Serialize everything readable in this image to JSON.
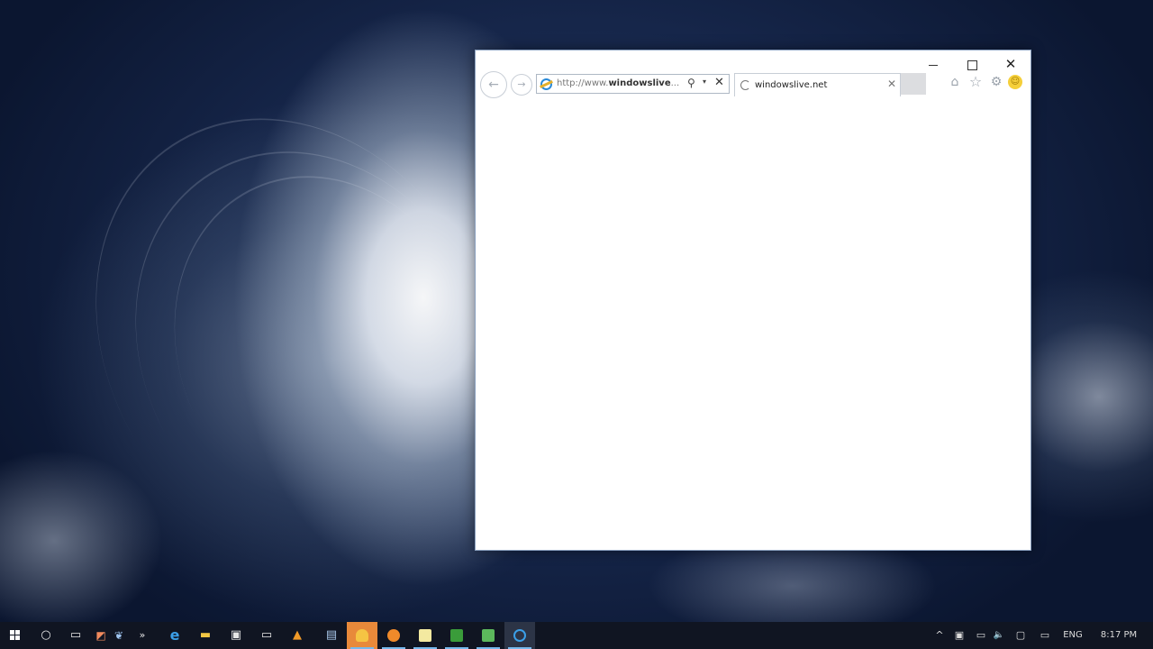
{
  "browser": {
    "window_controls": {
      "minimize": "─",
      "maximize": "",
      "close": "✕"
    },
    "nav": {
      "back_icon": "←",
      "forward_icon": "→"
    },
    "address": {
      "prefix": "http://www.",
      "domain": "windowslive",
      "suffix": "...",
      "search_icon": "⚲",
      "dropdown_icon": "▾",
      "stop_icon": "✕"
    },
    "tab": {
      "title": "windowslive.net",
      "close_icon": "✕"
    },
    "toolbar": {
      "home_icon": "⌂",
      "favorites_icon": "☆",
      "settings_icon": "⚙",
      "feedback_icon": "☺"
    }
  },
  "taskbar": {
    "items": [
      {
        "name": "cortana-search-icon",
        "glyph": "○"
      },
      {
        "name": "task-view-icon",
        "glyph": "▭"
      },
      {
        "name": "app-icon-1",
        "glyph": "◩"
      },
      {
        "name": "app-icon-2",
        "glyph": "❦"
      },
      {
        "name": "overflow-chevron-icon",
        "glyph": "»"
      },
      {
        "name": "edge-browser-icon",
        "glyph": "e"
      },
      {
        "name": "file-explorer-icon",
        "glyph": "▬"
      },
      {
        "name": "store-icon",
        "glyph": "▣"
      },
      {
        "name": "terminal-icon",
        "glyph": "▭"
      },
      {
        "name": "vlc-icon",
        "glyph": "▲"
      },
      {
        "name": "notepad-icon",
        "glyph": "▤"
      }
    ],
    "tray": {
      "show_hidden_icon": "^",
      "network_icon": "▭",
      "volume_icon": "🔈",
      "action_center_icon": "▢",
      "keyboard_icon": "▭",
      "language": "ENG",
      "time": "8:17 PM"
    }
  },
  "colors": {
    "taskbar_bg": "#101522",
    "taskbar_accent": "#76b9ed",
    "ie_blue": "#2a8ad8"
  }
}
